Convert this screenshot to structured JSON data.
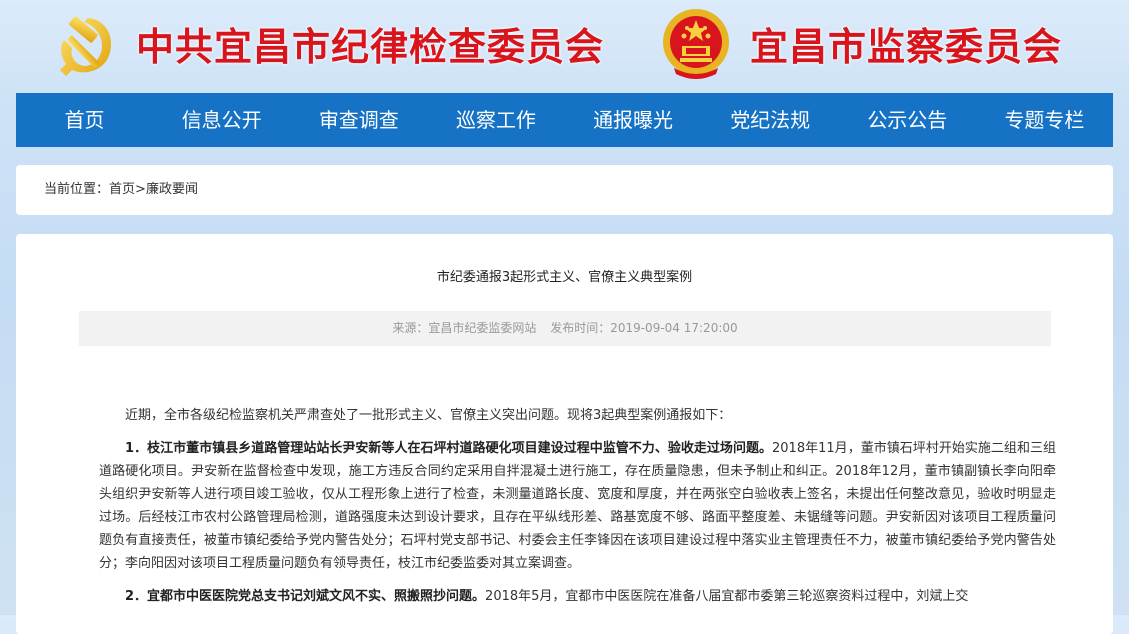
{
  "header": {
    "title_left": "中共宜昌市纪律检查委员会",
    "title_right": "宜昌市监察委员会",
    "emblem_left_icon": "party-emblem-icon",
    "emblem_right_icon": "national-emblem-icon",
    "title_color": "#d8151c"
  },
  "nav": {
    "bg_color": "#1572c4",
    "items": [
      "首页",
      "信息公开",
      "审查调查",
      "巡察工作",
      "通报曝光",
      "党纪法规",
      "公示公告",
      "专题专栏"
    ]
  },
  "breadcrumb": {
    "label": "当前位置：",
    "home": "首页",
    "separator": ">",
    "current": "廉政要闻"
  },
  "article": {
    "title": "市纪委通报3起形式主义、官僚主义典型案例",
    "source_label": "来源：宜昌市纪委监委网站",
    "time_label": "发布时间：2019-09-04 17:20:00",
    "intro": "近期，全市各级纪检监察机关严肃查处了一批形式主义、官僚主义突出问题。现将3起典型案例通报如下：",
    "case1_heading": "1．枝江市董市镇县乡道路管理站站长尹安新等人在石坪村道路硬化项目建设过程中监管不力、验收走过场问题。",
    "case1_body": "2018年11月，董市镇石坪村开始实施二组和三组道路硬化项目。尹安新在监督检查中发现，施工方违反合同约定采用自拌混凝土进行施工，存在质量隐患，但未予制止和纠正。2018年12月，董市镇副镇长李向阳牵头组织尹安新等人进行项目竣工验收，仅从工程形象上进行了检查，未测量道路长度、宽度和厚度，并在两张空白验收表上签名，未提出任何整改意见，验收时明显走过场。后经枝江市农村公路管理局检测，道路强度未达到设计要求，且存在平纵线形差、路基宽度不够、路面平整度差、未锯缝等问题。尹安新因对该项目工程质量问题负有直接责任，被董市镇纪委给予党内警告处分；石坪村党支部书记、村委会主任李锋因在该项目建设过程中落实业主管理责任不力，被董市镇纪委给予党内警告处分；李向阳因对该项目工程质量问题负有领导责任，枝江市纪委监委对其立案调查。",
    "case2_heading": "2．宜都市中医医院党总支书记刘斌文风不实、照搬照抄问题。",
    "case2_body": "2018年5月，宜都市中医医院在准备八届宜都市委第三轮巡察资料过程中，刘斌上交"
  }
}
